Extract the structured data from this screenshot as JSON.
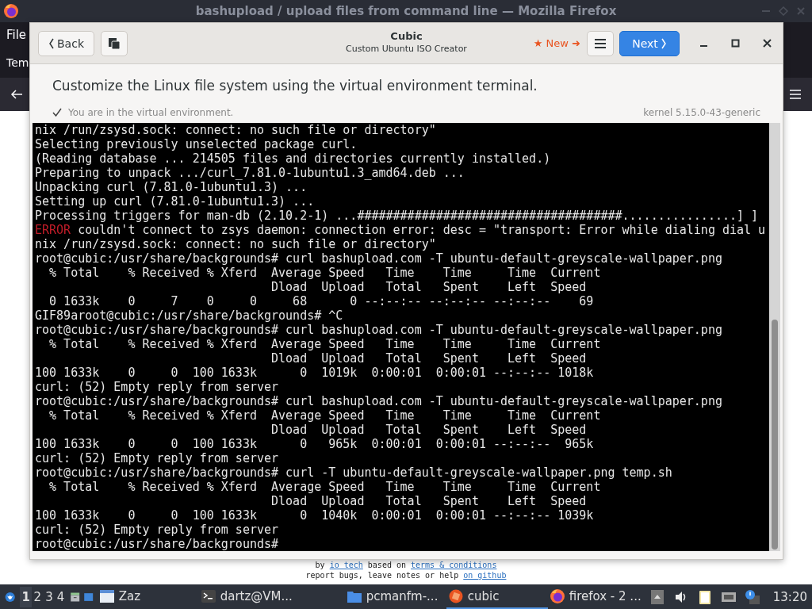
{
  "browser": {
    "title": "bashupload / upload files from command line — Mozilla Firefox",
    "menu": [
      "File"
    ],
    "tab": "Tem",
    "footer": [
      [
        {
          "kind": "text",
          "text": "by "
        },
        {
          "kind": "link",
          "text": "io tech"
        },
        {
          "kind": "text",
          "text": " based on "
        },
        {
          "kind": "link",
          "text": "terms & conditions"
        }
      ],
      [
        {
          "kind": "text",
          "text": "report bugs, leave notes or help "
        },
        {
          "kind": "link",
          "text": "on github"
        }
      ]
    ]
  },
  "cubic": {
    "back_button": "Back",
    "title": "Cubic",
    "subtitle": "Custom Ubuntu ISO Creator",
    "new_badge": "★ New ➜",
    "next_button": "Next",
    "heading": "Customize the Linux file system using the virtual environment terminal.",
    "status": "You are in the virtual environment.",
    "kernel": "kernel 5.15.0-43-generic",
    "terminal": [
      {
        "kind": "plain",
        "text": "nix /run/zsysd.sock: connect: no such file or directory\""
      },
      {
        "kind": "plain",
        "text": "Selecting previously unselected package curl."
      },
      {
        "kind": "plain",
        "text": "(Reading database ... 214505 files and directories currently installed.)"
      },
      {
        "kind": "plain",
        "text": "Preparing to unpack .../curl_7.81.0-1ubuntu1.3_amd64.deb ..."
      },
      {
        "kind": "plain",
        "text": "Unpacking curl (7.81.0-1ubuntu1.3) ..."
      },
      {
        "kind": "plain",
        "text": "Setting up curl (7.81.0-1ubuntu1.3) ..."
      },
      {
        "kind": "plain",
        "text": "Processing triggers for man-db (2.10.2-1) ...#####################################................] ]"
      },
      {
        "kind": "error",
        "label": "ERROR",
        "text": " couldn't connect to zsys daemon: connection error: desc = \"transport: Error while dialing dial u"
      },
      {
        "kind": "plain",
        "text": "nix /run/zsysd.sock: connect: no such file or directory\""
      },
      {
        "kind": "plain",
        "text": "root@cubic:/usr/share/backgrounds# curl bashupload.com -T ubuntu-default-greyscale-wallpaper.png"
      },
      {
        "kind": "plain",
        "text": "  % Total    % Received % Xferd  Average Speed   Time    Time     Time  Current"
      },
      {
        "kind": "plain",
        "text": "                                 Dload  Upload   Total   Spent    Left  Speed"
      },
      {
        "kind": "plain",
        "text": "  0 1633k    0     7    0     0     68      0 --:--:-- --:--:-- --:--:--    69"
      },
      {
        "kind": "plain",
        "text": "GIF89aroot@cubic:/usr/share/backgrounds# ^C"
      },
      {
        "kind": "plain",
        "text": "root@cubic:/usr/share/backgrounds# curl bashupload.com -T ubuntu-default-greyscale-wallpaper.png"
      },
      {
        "kind": "plain",
        "text": "  % Total    % Received % Xferd  Average Speed   Time    Time     Time  Current"
      },
      {
        "kind": "plain",
        "text": "                                 Dload  Upload   Total   Spent    Left  Speed"
      },
      {
        "kind": "plain",
        "text": "100 1633k    0     0  100 1633k      0  1019k  0:00:01  0:00:01 --:--:-- 1018k"
      },
      {
        "kind": "plain",
        "text": "curl: (52) Empty reply from server"
      },
      {
        "kind": "plain",
        "text": "root@cubic:/usr/share/backgrounds# curl bashupload.com -T ubuntu-default-greyscale-wallpaper.png"
      },
      {
        "kind": "plain",
        "text": "  % Total    % Received % Xferd  Average Speed   Time    Time     Time  Current"
      },
      {
        "kind": "plain",
        "text": "                                 Dload  Upload   Total   Spent    Left  Speed"
      },
      {
        "kind": "plain",
        "text": "100 1633k    0     0  100 1633k      0   965k  0:00:01  0:00:01 --:--:--  965k"
      },
      {
        "kind": "plain",
        "text": "curl: (52) Empty reply from server"
      },
      {
        "kind": "plain",
        "text": "root@cubic:/usr/share/backgrounds# curl -T ubuntu-default-greyscale-wallpaper.png temp.sh"
      },
      {
        "kind": "plain",
        "text": "  % Total    % Received % Xferd  Average Speed   Time    Time     Time  Current"
      },
      {
        "kind": "plain",
        "text": "                                 Dload  Upload   Total   Spent    Left  Speed"
      },
      {
        "kind": "plain",
        "text": "100 1633k    0     0  100 1633k      0  1040k  0:00:01  0:00:01 --:--:-- 1039k"
      },
      {
        "kind": "plain",
        "text": "curl: (52) Empty reply from server"
      },
      {
        "kind": "plain",
        "text": "root@cubic:/usr/share/backgrounds#"
      }
    ]
  },
  "taskbar": {
    "workspaces": [
      {
        "label": "1",
        "selected": true
      },
      {
        "label": "2",
        "selected": false
      },
      {
        "label": "3",
        "selected": false
      },
      {
        "label": "4",
        "selected": false
      }
    ],
    "tasks": [
      {
        "kind": "window",
        "label": "Zaz",
        "selected": false
      },
      {
        "kind": "terminal",
        "label": "dartz@VM...",
        "selected": false
      },
      {
        "kind": "folder",
        "label": "pcmanfm-...",
        "selected": false
      },
      {
        "kind": "cubic",
        "label": "cubic",
        "selected": true
      },
      {
        "kind": "firefox",
        "label": "firefox - 2 ...",
        "selected": false
      }
    ],
    "clock": "13:20"
  }
}
